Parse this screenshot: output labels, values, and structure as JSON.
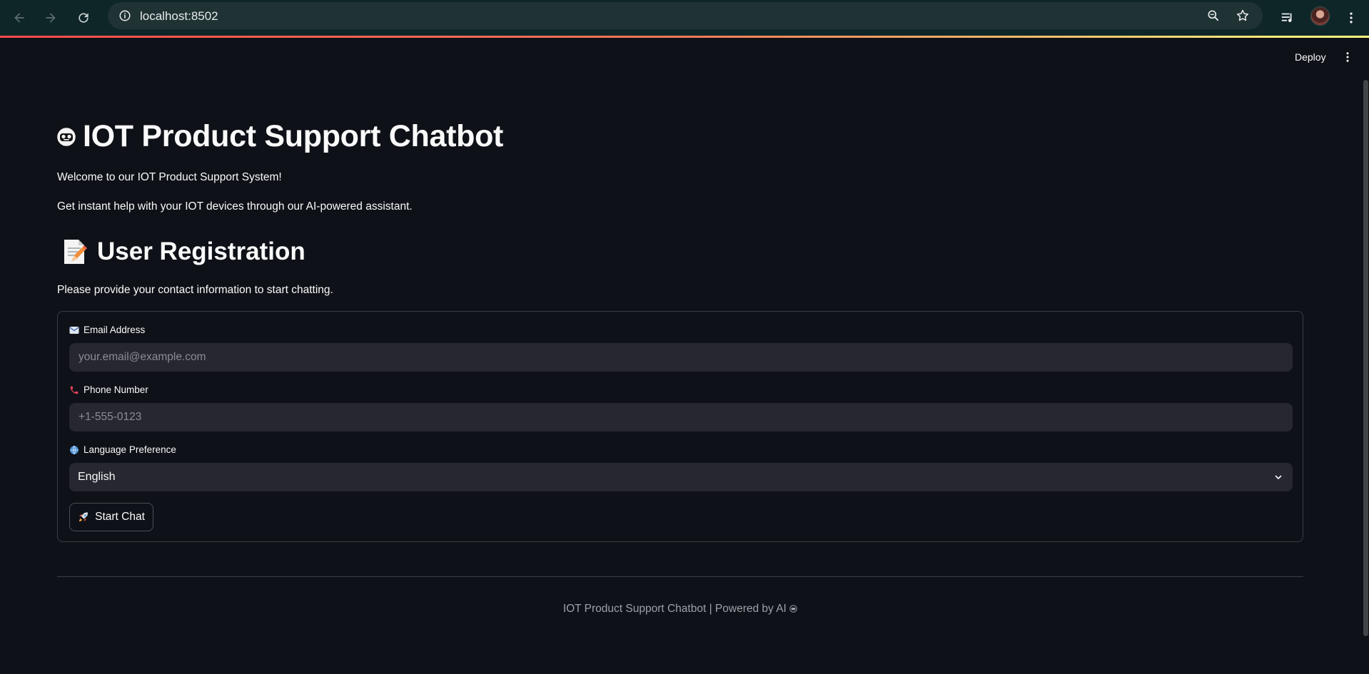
{
  "browser": {
    "url": "localhost:8502"
  },
  "header": {
    "deploy_label": "Deploy"
  },
  "main": {
    "title": "IOT Product Support Chatbot",
    "title_icon": "robot-icon",
    "welcome": "Welcome to our IOT Product Support System!",
    "subtitle": "Get instant help with your IOT devices through our AI-powered assistant."
  },
  "registration": {
    "title": "User Registration",
    "title_icon": "memo-icon",
    "instructions": "Please provide your contact information to start chatting.",
    "email": {
      "label": "Email Address",
      "icon": "email-icon",
      "placeholder": "your.email@example.com",
      "value": ""
    },
    "phone": {
      "label": "Phone Number",
      "icon": "phone-icon",
      "placeholder": "+1-555-0123",
      "value": ""
    },
    "language": {
      "label": "Language Preference",
      "icon": "globe-icon",
      "selected": "English"
    },
    "start_button": {
      "label": "Start Chat",
      "icon": "rocket-icon"
    }
  },
  "footer": {
    "text": "IOT Product Support Chatbot | Powered by AI"
  },
  "colors": {
    "background": "#0e1117",
    "input_bg": "#262730",
    "chrome_bg": "#0f2628",
    "text": "#fafafa"
  }
}
